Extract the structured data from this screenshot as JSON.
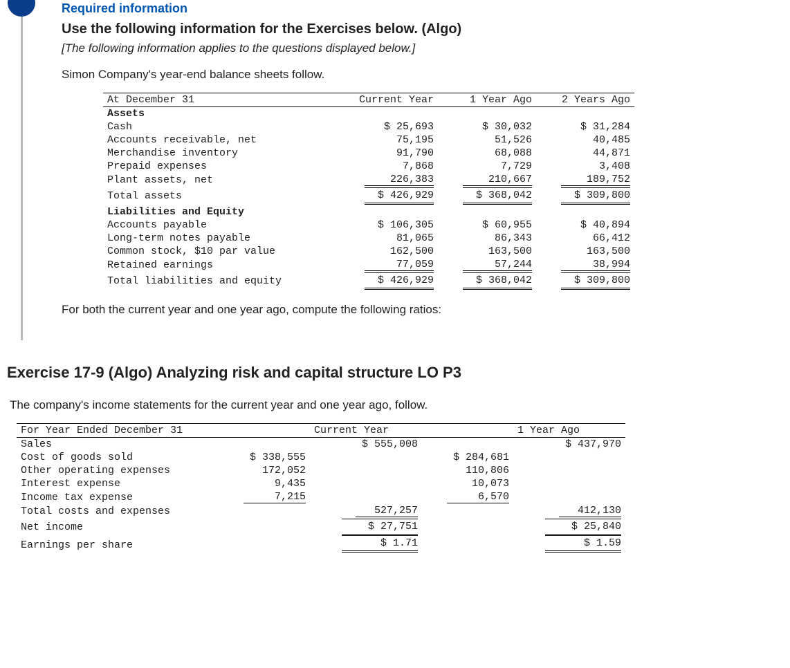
{
  "info": {
    "required": "Required information",
    "use_following": "Use the following information for the Exercises below. (Algo)",
    "applies": "[The following information applies to the questions displayed below.]",
    "lead": "Simon Company's year-end balance sheets follow.",
    "after_table": "For both the current year and one year ago, compute the following ratios:"
  },
  "balance_sheet": {
    "header": {
      "date": "At December 31",
      "c0": "Current Year",
      "c1": "1 Year Ago",
      "c2": "2 Years Ago"
    },
    "assets_label": "Assets",
    "assets": [
      {
        "label": "Cash",
        "c0": "$ 25,693",
        "c1": "$ 30,032",
        "c2": "$ 31,284"
      },
      {
        "label": "Accounts receivable, net",
        "c0": "75,195",
        "c1": "51,526",
        "c2": "40,485"
      },
      {
        "label": "Merchandise inventory",
        "c0": "91,790",
        "c1": "68,088",
        "c2": "44,871"
      },
      {
        "label": "Prepaid expenses",
        "c0": "7,868",
        "c1": "7,729",
        "c2": "3,408"
      },
      {
        "label": "Plant assets, net",
        "c0": "226,383",
        "c1": "210,667",
        "c2": "189,752"
      }
    ],
    "total_assets": {
      "label": "Total assets",
      "c0": "$ 426,929",
      "c1": "$ 368,042",
      "c2": "$ 309,800"
    },
    "liab_label": "Liabilities and Equity",
    "liab": [
      {
        "label": "Accounts payable",
        "c0": "$ 106,305",
        "c1": "$ 60,955",
        "c2": "$ 40,894"
      },
      {
        "label": "Long-term notes payable",
        "c0": "81,065",
        "c1": "86,343",
        "c2": "66,412"
      },
      {
        "label": "Common stock, $10 par value",
        "c0": "162,500",
        "c1": "163,500",
        "c2": "163,500"
      },
      {
        "label": "Retained earnings",
        "c0": "77,059",
        "c1": "57,244",
        "c2": "38,994"
      }
    ],
    "total_liab": {
      "label": "Total liabilities and equity",
      "c0": "$ 426,929",
      "c1": "$ 368,042",
      "c2": "$ 309,800"
    }
  },
  "exercise_title": "Exercise 17-9 (Algo) Analyzing risk and capital structure LO P3",
  "income_lead": "The company's income statements for the current year and one year ago, follow.",
  "income": {
    "header": {
      "date": "For Year Ended December 31",
      "c0": "Current Year",
      "c1": "1 Year Ago"
    },
    "sales": {
      "label": "Sales",
      "c0": "$ 555,008",
      "c1": "$ 437,970"
    },
    "expenses": [
      {
        "label": "Cost of goods sold",
        "c0": "$ 338,555",
        "c1": "$ 284,681"
      },
      {
        "label": "Other operating expenses",
        "c0": "172,052",
        "c1": "110,806"
      },
      {
        "label": "Interest expense",
        "c0": "9,435",
        "c1": "10,073"
      },
      {
        "label": "Income tax expense",
        "c0": "7,215",
        "c1": "6,570"
      }
    ],
    "total_exp": {
      "label": "Total costs and expenses",
      "c0": "527,257",
      "c1": "412,130"
    },
    "net_income": {
      "label": "Net income",
      "c0": "$ 27,751",
      "c1": "$ 25,840"
    },
    "eps": {
      "label": "Earnings per share",
      "c0": "$ 1.71",
      "c1": "$ 1.59"
    }
  }
}
